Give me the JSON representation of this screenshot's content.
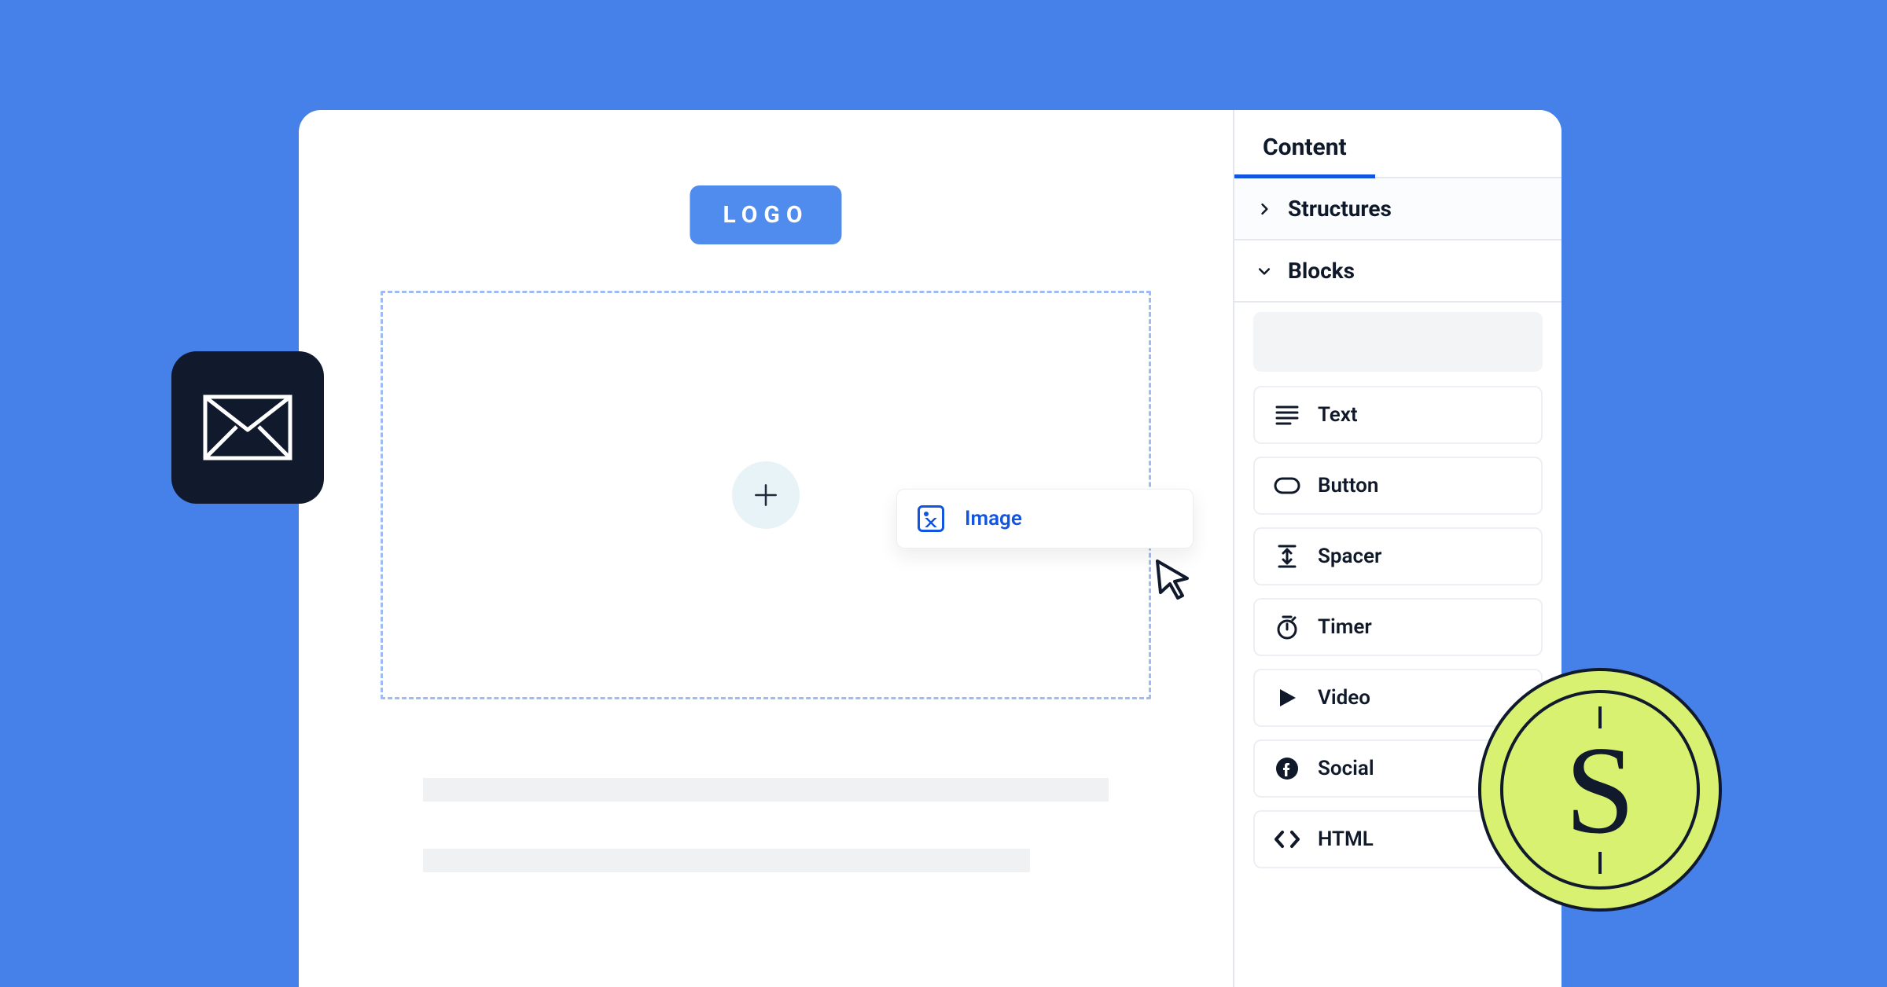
{
  "canvas": {
    "logo_label": "LOGO",
    "drag_block_label": "Image"
  },
  "sidebar": {
    "tab_content": "Content",
    "section_structures": "Structures",
    "section_blocks": "Blocks",
    "blocks": [
      {
        "label": "Text"
      },
      {
        "label": "Button"
      },
      {
        "label": "Spacer"
      },
      {
        "label": "Timer"
      },
      {
        "label": "Video"
      },
      {
        "label": "Social"
      },
      {
        "label": "HTML"
      }
    ]
  }
}
